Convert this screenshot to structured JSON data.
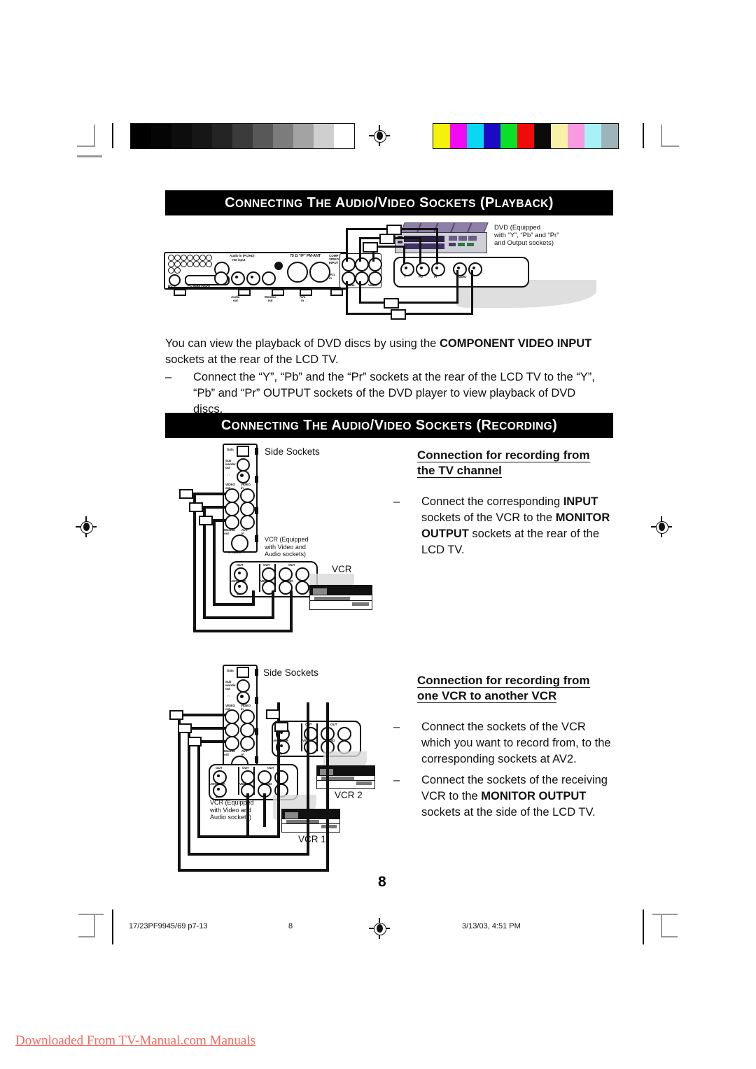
{
  "document": {
    "page_number": "8",
    "sections": [
      {
        "id": "playback",
        "banner": [
          {
            "t": "C",
            "caps": true
          },
          {
            "t": "ONNECTING",
            "caps": false
          },
          {
            "t": " ",
            "caps": false
          },
          {
            "t": "T",
            "caps": true
          },
          {
            "t": "HE",
            "caps": false
          },
          {
            "t": " ",
            "caps": false
          },
          {
            "t": "A",
            "caps": true
          },
          {
            "t": "UDIO",
            "caps": false
          },
          {
            "t": "/",
            "caps": true
          },
          {
            "t": "V",
            "caps": true
          },
          {
            "t": "IDEO",
            "caps": false
          },
          {
            "t": " ",
            "caps": false
          },
          {
            "t": "S",
            "caps": true
          },
          {
            "t": "OCKETS",
            "caps": false
          },
          {
            "t": " (",
            "caps": true
          },
          {
            "t": "P",
            "caps": true
          },
          {
            "t": "LAYBACK",
            "caps": false
          },
          {
            "t": ")",
            "caps": true
          }
        ],
        "banner_text": "CONNECTING THE AUDIO/VIDEO SOCKETS (PLAYBACK)"
      },
      {
        "id": "recording",
        "banner_text": "CONNECTING THE AUDIO/VIDEO SOCKETS (RECORDING)"
      }
    ]
  },
  "playback": {
    "intro_p1_a": "You can view the playback of DVD discs by using the ",
    "intro_p1_bold": "COMPONENT  VIDEO  INPUT",
    "intro_p1_b": " sockets at the rear of the LCD  TV.",
    "bullet_dash": "–",
    "bullet_1": "Connect the “Y”, “Pb” and the “Pr” sockets at the rear of the LCD TV to the “Y”, “Pb” and “Pr” OUTPUT sockets of the DVD player to view playback of DVD discs.",
    "dvd_callout": "DVD (Equipped\nwith “Y”, “Pb” and “Pr”\nand Output sockets)",
    "rear_labels": {
      "dc_in": "DC in",
      "pc_input": "PC input (VGA)",
      "audio_in": "Audio in (PC/HD)",
      "hd_input": "HD input",
      "ant": "75 Ω “IF”  FM-ANT",
      "comp_video_input": "COMP\nVIDEO\nINPUT",
      "av1_in": "AV1\nin",
      "audio_out": "Audio\nout",
      "monitor_out": "Monitor\nout",
      "av1_in_bottom": "AV1\nin",
      "y": "Y",
      "pb": "Pb",
      "pr": "Pr",
      "audio": "Audio",
      "video": "Video",
      "r": "R",
      "l": "L"
    },
    "dvd_panel_labels": {
      "y": "Y",
      "pb": "Pb",
      "pr": "Pr",
      "audio": "AUDIO"
    }
  },
  "recording": {
    "sub1_line1": "Connection for recording from",
    "sub1_line2": "the TV channel",
    "sub1_bullet_dash": "–",
    "sub1_bullet_pre": "Connect the corresponding ",
    "sub1_bullet_b1": "INPUT",
    "sub1_bullet_mid": " sockets of the VCR to the ",
    "sub1_bullet_b2": "MONITOR OUTPUT",
    "sub1_bullet_end": " sockets at the rear of the LCD TV.",
    "sub2_line1": "Connection for recording from",
    "sub2_line2": "one VCR to another  VCR",
    "sub2_bullet1": "Connect the sockets of the VCR which you want to record from, to the corresponding sockets at AV2.",
    "sub2_bullet2_pre": "Connect the sockets of the receiving VCR to the ",
    "sub2_bullet2_b": "MONITOR OUTPUT",
    "sub2_bullet2_end": " sockets at the side of the LCD TV.",
    "callout_side_sockets": "Side Sockets",
    "callout_vcr_equipped": "VCR (Equipped\nwith Video and\nAudio sockets)",
    "callout_vcr": "VCR",
    "callout_vcr1": "VCR 1",
    "callout_vcr2": "VCR 2",
    "side_panel_labels": {
      "data": "Data",
      "sub_woofer_out": "Sub\nwoofer\nout",
      "headphone": "∩",
      "video_out": "VIDEO\nout",
      "video_in": "VIDEO\nin",
      "monitor_out": "Monitor\nout",
      "av2_in": "AV2\nin",
      "s_video": "S-VIDEO",
      "r": "R",
      "l": "L"
    },
    "vcr_panel_labels": {
      "out": "OUT",
      "in": "IN",
      "antenna": "ANTENNA",
      "video": "VIDEO",
      "audio": "AUDIO",
      "r": "R",
      "l": "L"
    }
  },
  "footer": {
    "file_ref": "17/23PF9945/69 p7-13",
    "page": "8",
    "timestamp": "3/13/03, 4:51 PM"
  },
  "watermark": "Downloaded From TV-Manual.com Manuals",
  "colors": {
    "banner_bg": "#000000",
    "banner_fg": "#ffffff",
    "watermark": "#f4685f",
    "gray_bars": [
      "#000000",
      "#050505",
      "#0d0d0d",
      "#161616",
      "#242424",
      "#3b3b3b",
      "#585858",
      "#7c7c7c",
      "#a3a3a3",
      "#cfcfcf",
      "#ffffff"
    ],
    "color_bars": [
      "#f2f20a",
      "#f20af2",
      "#0ad7f2",
      "#1a0ac6",
      "#0ae028",
      "#f20a0a",
      "#0b0b0b",
      "#f7f2a8",
      "#f79ae0",
      "#a8f2f7",
      "#9fb4b8"
    ]
  }
}
